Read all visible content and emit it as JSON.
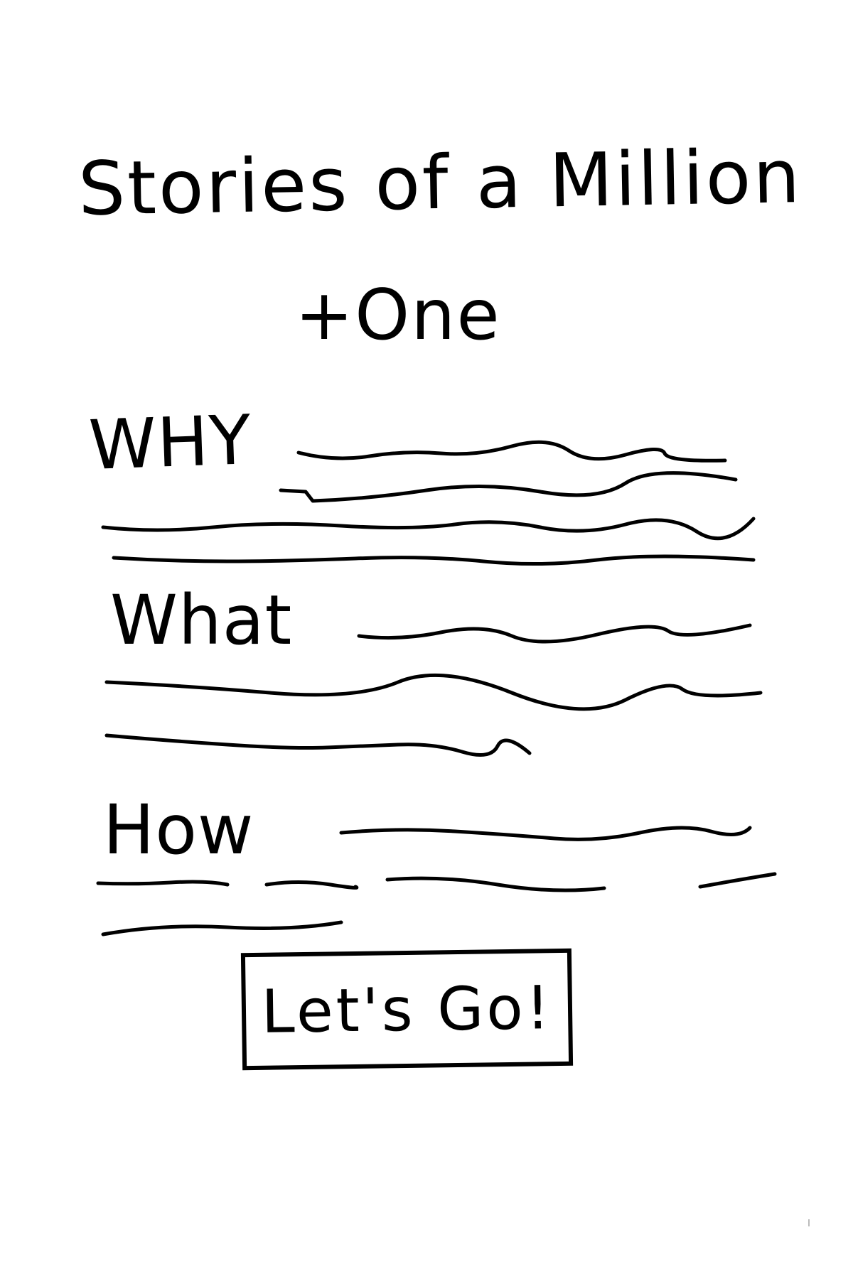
{
  "title": {
    "line1": "Stories of a Million",
    "line2": "+One"
  },
  "sections": [
    {
      "heading": "WHY"
    },
    {
      "heading": "What"
    },
    {
      "heading": "How"
    }
  ],
  "cta": {
    "label": "Let's Go!"
  }
}
